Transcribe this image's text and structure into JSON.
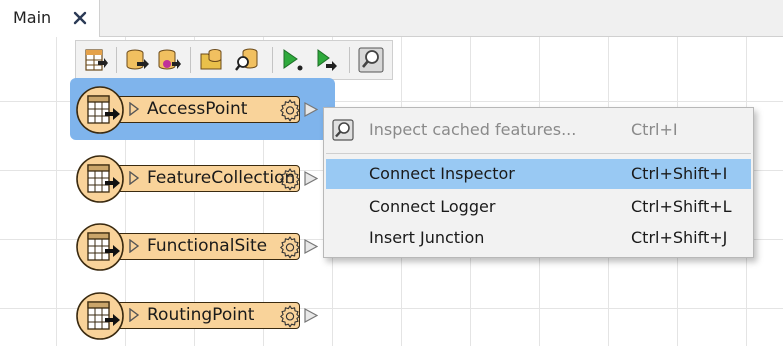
{
  "tab": {
    "title": "Main"
  },
  "toolbar": {
    "buttons": [
      "table-add-icon",
      "db-arrow-icon",
      "db-gear-icon",
      "folder-db-icon",
      "search-db-icon",
      "run-icon",
      "run-to-icon",
      "inspect-icon"
    ]
  },
  "nodes": [
    {
      "label": "AccessPoint",
      "selected": true
    },
    {
      "label": "FeatureCollection",
      "selected": false
    },
    {
      "label": "FunctionalSite",
      "selected": false
    },
    {
      "label": "RoutingPoint",
      "selected": false
    }
  ],
  "context_menu": {
    "items": [
      {
        "label": "Inspect cached features...",
        "shortcut": "Ctrl+I",
        "disabled": true,
        "icon": "inspect-icon"
      },
      {
        "label": "Connect Inspector",
        "shortcut": "Ctrl+Shift+I",
        "highlighted": true
      },
      {
        "label": "Connect Logger",
        "shortcut": "Ctrl+Shift+L"
      },
      {
        "label": "Insert Junction",
        "shortcut": "Ctrl+Shift+J"
      }
    ]
  },
  "colors": {
    "node_fill": "#f9d39a",
    "selection": "#7fb4ec",
    "menu_highlight": "#99c9f3"
  }
}
